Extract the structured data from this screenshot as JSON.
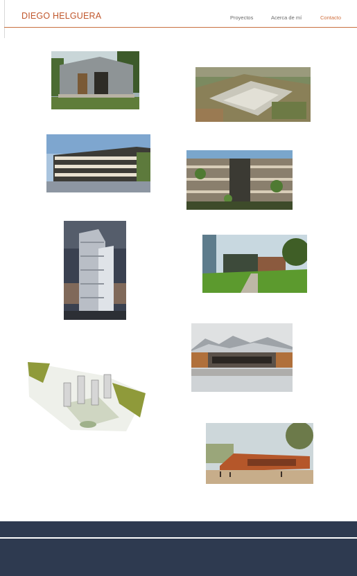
{
  "header": {
    "brand": "DIEGO HELGUERA",
    "nav": [
      {
        "label": "Proyectos",
        "active": false
      },
      {
        "label": "Acerca de mí",
        "active": false
      },
      {
        "label": "Contacto",
        "active": true
      }
    ]
  },
  "colors": {
    "accent": "#c0562b",
    "nav_text": "#6a6a6a",
    "footer": "#2e3a50"
  },
  "gallery": [
    {
      "name": "cabin-house-photo"
    },
    {
      "name": "aerial-masterplan-render"
    },
    {
      "name": "apartment-building-render"
    },
    {
      "name": "green-facade-building-render"
    },
    {
      "name": "office-tower-render"
    },
    {
      "name": "modern-house-garden-photo"
    },
    {
      "name": "mountain-pavilion-render"
    },
    {
      "name": "isometric-site-plan"
    },
    {
      "name": "corten-pavilion-render"
    }
  ]
}
